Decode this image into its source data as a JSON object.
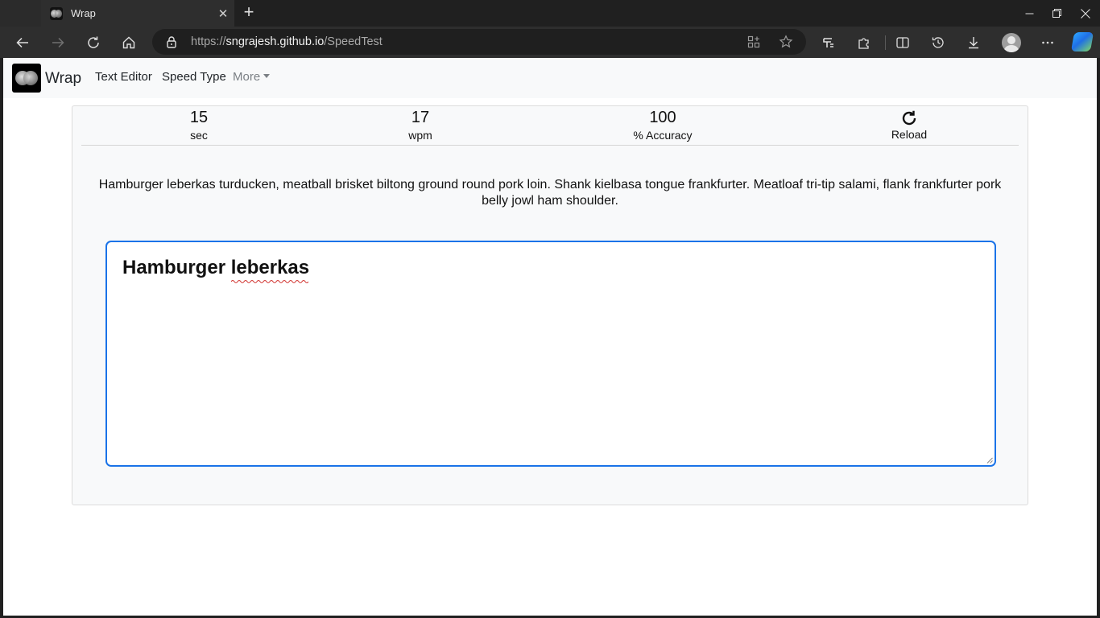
{
  "browser": {
    "tab_title": "Wrap",
    "url_scheme": "https://",
    "url_host": "sngrajesh.github.io",
    "url_path": "/SpeedTest"
  },
  "navbar": {
    "brand": "Wrap",
    "links": [
      "Text Editor",
      "Speed Type"
    ],
    "more_label": "More"
  },
  "stats": {
    "time": {
      "value": "15",
      "label": "sec"
    },
    "speed": {
      "value": "17",
      "label": "wpm"
    },
    "accuracy": {
      "value": "100",
      "label": "% Accuracy"
    },
    "reload_label": "Reload"
  },
  "prompt_text": "Hamburger leberkas turducken, meatball brisket biltong ground round pork loin. Shank kielbasa tongue frankfurter. Meatloaf tri-tip salami, flank frankfurter pork belly jowl ham shoulder.",
  "editor": {
    "typed_word_1": "Hamburger",
    "typed_word_2": "leberkas"
  },
  "colors": {
    "accent": "#1a73e8",
    "navbar_bg": "#f8f9fa",
    "chrome_bg": "#2e2e2e"
  }
}
